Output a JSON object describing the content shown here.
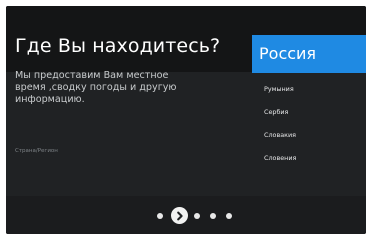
{
  "setup": {
    "title": "Где Вы находитесь?",
    "description": "Мы предоставим Вам местное время ,сводку погоды и другую информацию.",
    "region_label": "Страна/Регион"
  },
  "countries": {
    "selected": "Россия",
    "options": [
      "Румыния",
      "Сербия",
      "Словакия",
      "Словения"
    ]
  },
  "pager": {
    "current_page": 2,
    "total_pages": 5,
    "next_icon": "chevron-right-icon"
  },
  "colors": {
    "selected_background": "#1f8ae3",
    "screen_background": "#202224"
  }
}
